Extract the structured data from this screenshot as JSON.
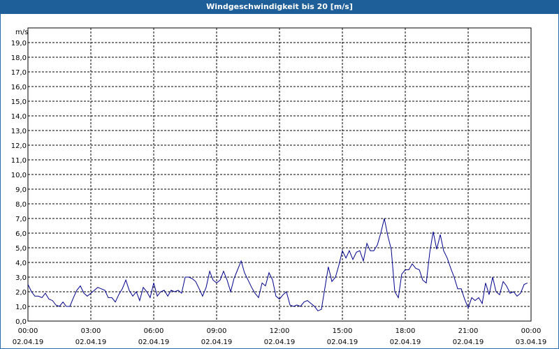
{
  "window": {
    "title": "Windgeschwindigkeit bis 20 [m/s]"
  },
  "chart_data": {
    "type": "line",
    "ylabel": "m/s",
    "ylim": [
      0,
      20
    ],
    "yticks": [
      "0,0",
      "1,0",
      "2,0",
      "3,0",
      "4,0",
      "5,0",
      "6,0",
      "7,0",
      "8,0",
      "9,0",
      "10,0",
      "11,0",
      "12,0",
      "13,0",
      "14,0",
      "15,0",
      "16,0",
      "17,0",
      "18,0",
      "19,0"
    ],
    "xlim_hours": [
      0,
      24
    ],
    "xticks": [
      {
        "time": "00:00",
        "date": "02.04.19"
      },
      {
        "time": "03:00",
        "date": "02.04.19"
      },
      {
        "time": "06:00",
        "date": "02.04.19"
      },
      {
        "time": "09:00",
        "date": "02.04.19"
      },
      {
        "time": "12:00",
        "date": "02.04.19"
      },
      {
        "time": "15:00",
        "date": "02.04.19"
      },
      {
        "time": "18:00",
        "date": "02.04.19"
      },
      {
        "time": "21:00",
        "date": "02.04.19"
      },
      {
        "time": "00:00",
        "date": "03.04.19"
      }
    ],
    "line_color": "#00008b",
    "grid": true,
    "series": [
      {
        "x": [
          0.0,
          0.17,
          0.33,
          0.5,
          0.67,
          0.83,
          1.0,
          1.17,
          1.33,
          1.5,
          1.67,
          1.83,
          2.0,
          2.17,
          2.33,
          2.5,
          2.67,
          2.83,
          3.0,
          3.17,
          3.33,
          3.5,
          3.67,
          3.83,
          4.0,
          4.17,
          4.33,
          4.5,
          4.67,
          4.83,
          5.0,
          5.17,
          5.33,
          5.5,
          5.67,
          5.83,
          6.0,
          6.17,
          6.33,
          6.5,
          6.67,
          6.83,
          7.0,
          7.17,
          7.33,
          7.5,
          7.67,
          7.83,
          8.0,
          8.17,
          8.33,
          8.5,
          8.67,
          8.83,
          9.0,
          9.17,
          9.33,
          9.5,
          9.67,
          9.83,
          10.0,
          10.17,
          10.33,
          10.5,
          10.67,
          10.83,
          11.0,
          11.17,
          11.33,
          11.5,
          11.67,
          11.83,
          12.0,
          12.17,
          12.33,
          12.5,
          12.67,
          12.83,
          13.0,
          13.17,
          13.33,
          13.5,
          13.67,
          13.83,
          14.0,
          14.17,
          14.33,
          14.5,
          14.67,
          14.83,
          15.0,
          15.17,
          15.33,
          15.5,
          15.67,
          15.83,
          16.0,
          16.17,
          16.33,
          16.5,
          16.67,
          16.83,
          17.0,
          17.17,
          17.33,
          17.5,
          17.67,
          17.83,
          18.0,
          18.17,
          18.33,
          18.5,
          18.67,
          18.83,
          19.0,
          19.17,
          19.33,
          19.5,
          19.67,
          19.83,
          20.0,
          20.17,
          20.33,
          20.5,
          20.67,
          20.83,
          21.0,
          21.17,
          21.33,
          21.5,
          21.67,
          21.83,
          22.0,
          22.17,
          22.33,
          22.5,
          22.67,
          22.83,
          23.0,
          23.17,
          23.33,
          23.5,
          23.67,
          23.83
        ],
        "y": [
          2.5,
          2.0,
          1.7,
          1.7,
          1.6,
          1.9,
          1.5,
          1.4,
          1.1,
          1.0,
          1.3,
          1.0,
          1.0,
          1.6,
          2.1,
          2.4,
          1.9,
          1.7,
          1.9,
          2.1,
          2.3,
          2.2,
          2.1,
          1.6,
          1.6,
          1.3,
          1.8,
          2.2,
          2.8,
          2.1,
          1.7,
          2.0,
          1.4,
          2.3,
          2.0,
          1.6,
          2.6,
          1.7,
          2.0,
          2.1,
          1.7,
          2.1,
          2.0,
          2.1,
          1.9,
          3.0,
          3.0,
          2.9,
          2.7,
          2.2,
          1.7,
          2.3,
          3.4,
          2.8,
          2.6,
          2.8,
          3.4,
          2.8,
          2.0,
          2.9,
          3.5,
          4.1,
          3.3,
          2.8,
          2.3,
          1.9,
          1.6,
          2.6,
          2.4,
          3.3,
          2.8,
          1.7,
          1.5,
          1.8,
          2.0,
          1.1,
          1.0,
          1.1,
          1.0,
          1.3,
          1.4,
          1.2,
          1.0,
          0.7,
          0.8,
          2.3,
          3.7,
          2.7,
          3.0,
          3.8,
          4.8,
          4.3,
          4.8,
          4.2,
          4.7,
          4.8,
          4.1,
          5.3,
          4.8,
          4.8,
          5.2,
          6.0,
          7.0,
          5.8,
          4.9,
          2.0,
          1.6,
          3.2,
          3.5,
          3.5,
          3.9,
          3.6,
          3.5,
          2.8,
          2.6,
          4.7,
          6.1,
          4.9,
          5.9,
          4.8,
          4.3,
          3.6,
          3.0,
          2.2,
          2.2,
          1.5,
          0.9,
          1.6,
          1.4,
          1.6,
          1.2,
          2.6,
          1.8,
          3.0,
          2.0,
          1.8,
          2.7,
          2.4,
          1.9,
          2.0,
          1.7,
          1.9,
          2.5,
          2.6
        ]
      }
    ]
  }
}
